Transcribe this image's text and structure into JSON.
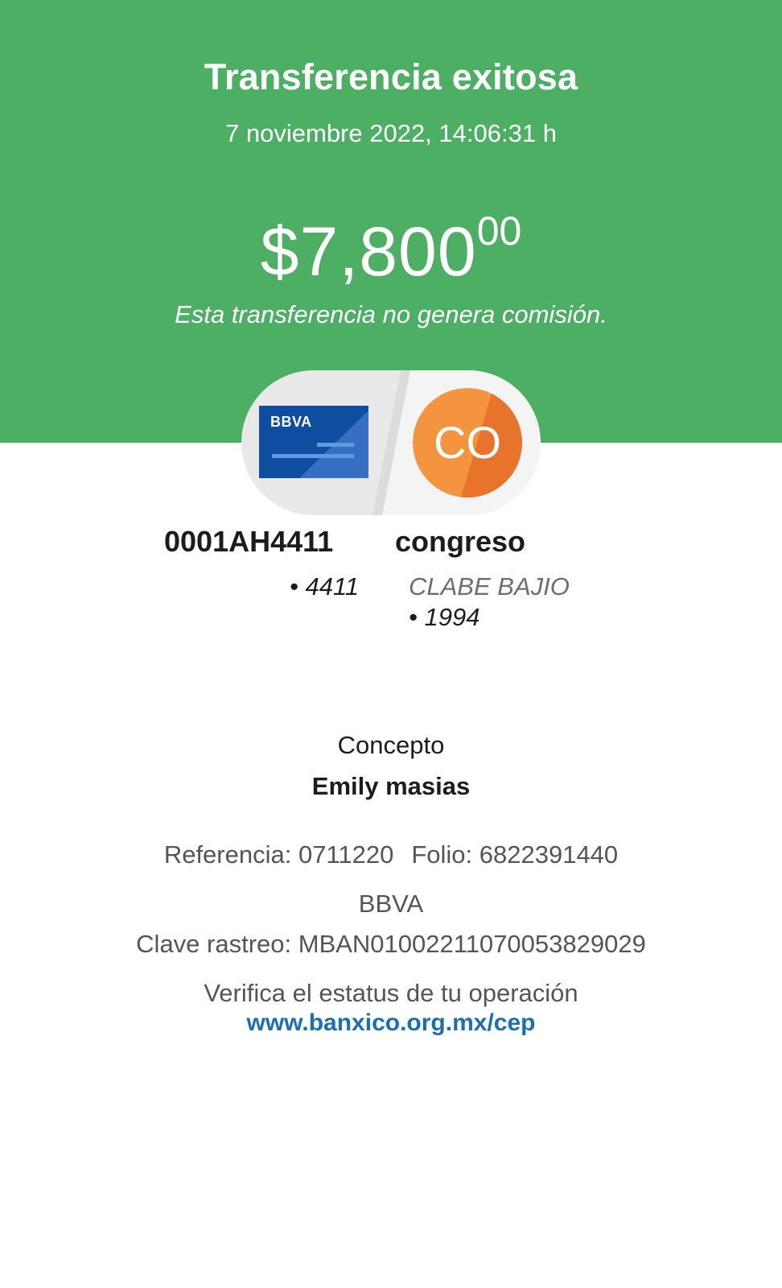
{
  "header": {
    "title": "Transferencia exitosa",
    "datetime": "7 noviembre 2022, 14:06:31 h",
    "amount_main": "$7,800",
    "amount_cents": "00",
    "commission_note": "Esta transferencia no genera comisión.",
    "background_color": "#4caf63"
  },
  "origin": {
    "bank_logo_text": "BBVA",
    "icon": "bank-card-icon",
    "account_name": "0001AH4411",
    "account_last": "• 4411"
  },
  "destination": {
    "initials": "CO",
    "name": "congreso",
    "bank": "CLABE BAJIO",
    "account_last": "• 1994",
    "avatar_color": "#f08a35"
  },
  "concept": {
    "label": "Concepto",
    "value": "Emily masias"
  },
  "details": {
    "reference": "Referencia: 0711220",
    "folio": "Folio: 6822391440",
    "bank": "BBVA",
    "tracking_key": "Clave rastreo: MBAN01002211070053829029"
  },
  "verify": {
    "text": "Verifica el estatus de tu operación",
    "link": "www.banxico.org.mx/cep",
    "link_color": "#1a6fb5"
  }
}
